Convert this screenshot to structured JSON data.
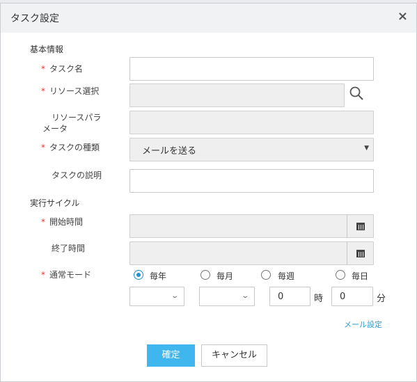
{
  "dialog": {
    "title": "タスク設定",
    "close_symbol": "×"
  },
  "sections": {
    "basic": "基本情報",
    "cycle": "実行サイクル"
  },
  "required_mark": "*",
  "fields": {
    "task_name": {
      "label": "タスク名",
      "value": ""
    },
    "resource_select": {
      "label": "リソース選択",
      "value": ""
    },
    "resource_params": {
      "label_line1": "リソースパラ",
      "label_line2": "メータ",
      "value": ""
    },
    "task_type": {
      "label": "タスクの種類",
      "value": "メールを送る"
    },
    "task_desc": {
      "label": "タスクの説明",
      "value": ""
    },
    "start_time": {
      "label": "開始時間",
      "value": ""
    },
    "end_time": {
      "label": "終了時間",
      "value": ""
    },
    "mode": {
      "label": "通常モード"
    }
  },
  "mode_options": [
    "毎年",
    "毎月",
    "毎週",
    "毎日"
  ],
  "mode_selected": "毎年",
  "schedule": {
    "hour_value": "0",
    "hour_unit": "時",
    "minute_value": "0",
    "minute_unit": "分"
  },
  "mail_link": "メール設定",
  "buttons": {
    "confirm": "確定",
    "cancel": "キャンセル"
  },
  "colors": {
    "accent": "#3fb6ee",
    "required": "#ee3333",
    "link": "#2a9fd6"
  }
}
